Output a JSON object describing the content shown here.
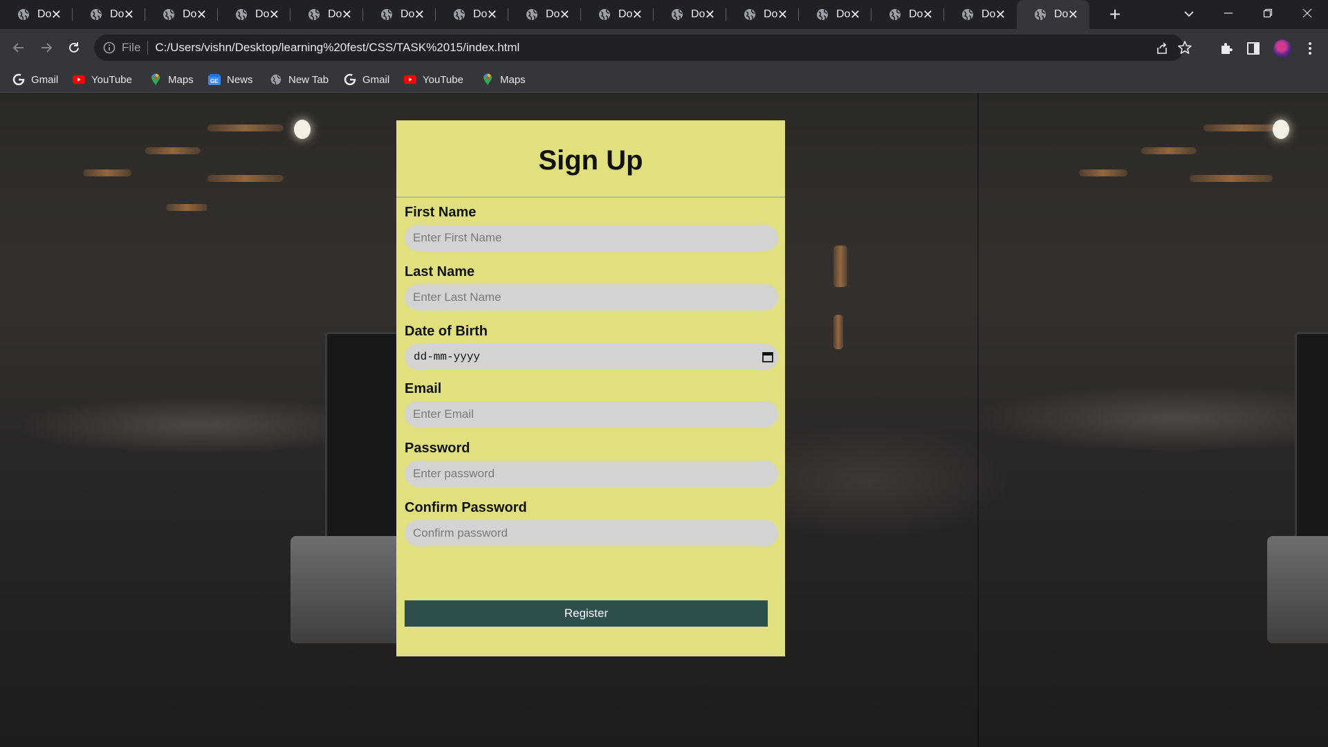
{
  "browser": {
    "tabs": [
      {
        "title": "Do"
      },
      {
        "title": "Do"
      },
      {
        "title": "Do"
      },
      {
        "title": "Do"
      },
      {
        "title": "Do"
      },
      {
        "title": "Do"
      },
      {
        "title": "Do"
      },
      {
        "title": "Do"
      },
      {
        "title": "Do"
      },
      {
        "title": "Do"
      },
      {
        "title": "Do"
      },
      {
        "title": "Do"
      },
      {
        "title": "Do"
      },
      {
        "title": "Do"
      },
      {
        "title": "Do"
      }
    ],
    "active_tab_index": 14,
    "address": {
      "scheme_label": "File",
      "url": "C:/Users/vishn/Desktop/learning%20fest/CSS/TASK%2015/index.html"
    },
    "bookmarks": [
      {
        "label": "Gmail",
        "icon": "google-icon"
      },
      {
        "label": "YouTube",
        "icon": "youtube-icon"
      },
      {
        "label": "Maps",
        "icon": "maps-icon"
      },
      {
        "label": "News",
        "icon": "news-icon"
      },
      {
        "label": "New Tab",
        "icon": "globe-icon"
      },
      {
        "label": "Gmail",
        "icon": "google-icon"
      },
      {
        "label": "YouTube",
        "icon": "youtube-icon"
      },
      {
        "label": "Maps",
        "icon": "maps-icon"
      }
    ]
  },
  "form": {
    "title": "Sign Up",
    "first_name": {
      "label": "First Name",
      "placeholder": "Enter First Name"
    },
    "last_name": {
      "label": "Last Name",
      "placeholder": "Enter Last Name"
    },
    "dob": {
      "label": "Date of Birth",
      "placeholder": "dd-mm-yyyy"
    },
    "email": {
      "label": "Email",
      "placeholder": "Enter Email"
    },
    "password": {
      "label": "Password",
      "placeholder": "Enter password"
    },
    "confirm_password": {
      "label": "Confirm Password",
      "placeholder": "Confirm password"
    },
    "register_label": "Register"
  },
  "colors": {
    "card_bg": "#e0e07f",
    "input_bg": "#d3d3d3",
    "button_bg": "#2f4f4f",
    "chrome_dark": "#202124",
    "chrome_toolbar": "#35363a"
  }
}
